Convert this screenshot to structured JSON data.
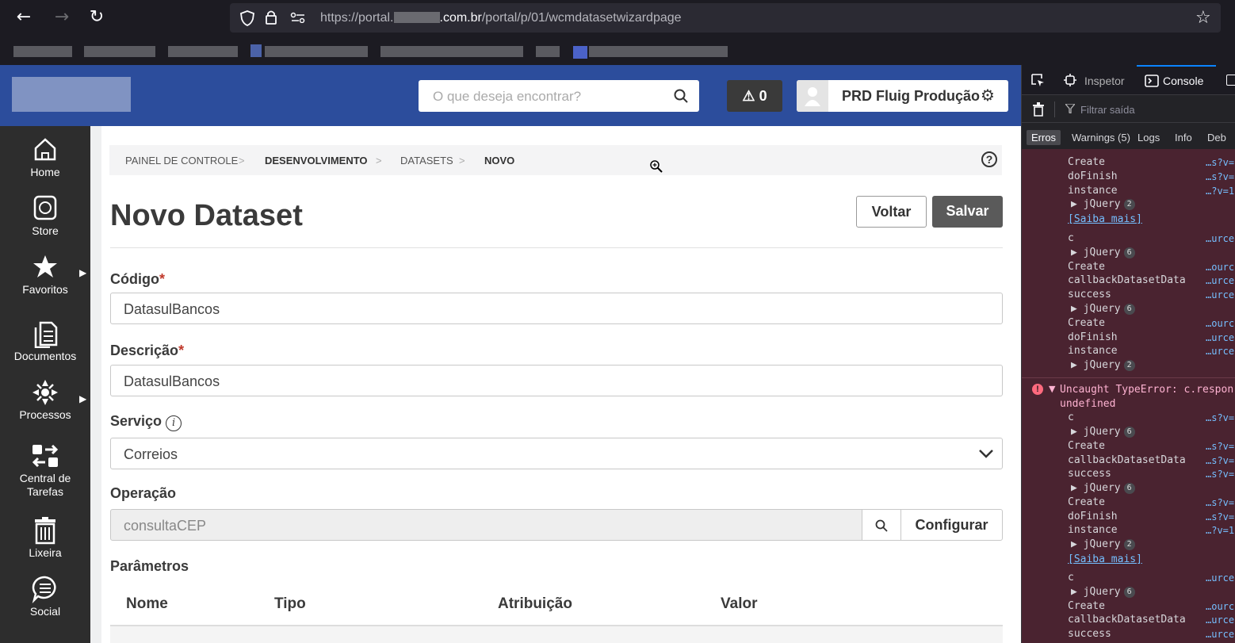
{
  "browser": {
    "url_prefix": "https://portal.",
    "url_domain_suffix": ".com.br",
    "url_path": "/portal/p/01/wcmdatasetwizardpage"
  },
  "header": {
    "search_placeholder": "O que deseja encontrar?",
    "alert_count": "0",
    "user_label": "PRD Fluig Produção"
  },
  "sidebar": {
    "items": [
      {
        "label": "Home",
        "icon": "home-icon"
      },
      {
        "label": "Store",
        "icon": "store-icon"
      },
      {
        "label": "Favoritos",
        "icon": "star-icon"
      },
      {
        "label": "Documentos",
        "icon": "documents-icon"
      },
      {
        "label": "Processos",
        "icon": "processes-icon"
      },
      {
        "label_line1": "Central de",
        "label_line2": "Tarefas",
        "icon": "tasks-icon"
      },
      {
        "label": "Lixeira",
        "icon": "trash-icon"
      },
      {
        "label": "Social",
        "icon": "chat-icon"
      }
    ]
  },
  "breadcrumb": [
    "PAINEL DE CONTROLE",
    "DESENVOLVIMENTO",
    "DATASETS",
    "NOVO"
  ],
  "page": {
    "title": "Novo Dataset",
    "back_label": "Voltar",
    "save_label": "Salvar"
  },
  "form": {
    "codigo_label": "Código",
    "codigo_value": "DatasulBancos",
    "descricao_label": "Descrição",
    "descricao_value": "DatasulBancos",
    "servico_label": "Serviço",
    "servico_value": "Correios",
    "operacao_label": "Operação",
    "operacao_value": "consultaCEP",
    "configurar_label": "Configurar",
    "parametros_label": "Parâmetros",
    "columns": [
      "Nome",
      "Tipo",
      "Atribuição",
      "Valor"
    ]
  },
  "devtools": {
    "tabs": {
      "inspector": "Inspetor",
      "console": "Console"
    },
    "filter_placeholder": "Filtrar saída",
    "levels": {
      "errors": "Erros",
      "warnings": "Warnings (5)",
      "logs": "Logs",
      "info": "Info",
      "debug": "Deb"
    },
    "error_message": "Uncaught TypeError: c.respon",
    "error_message_2": "undefined",
    "learn_more": "[Saiba mais]"
  }
}
